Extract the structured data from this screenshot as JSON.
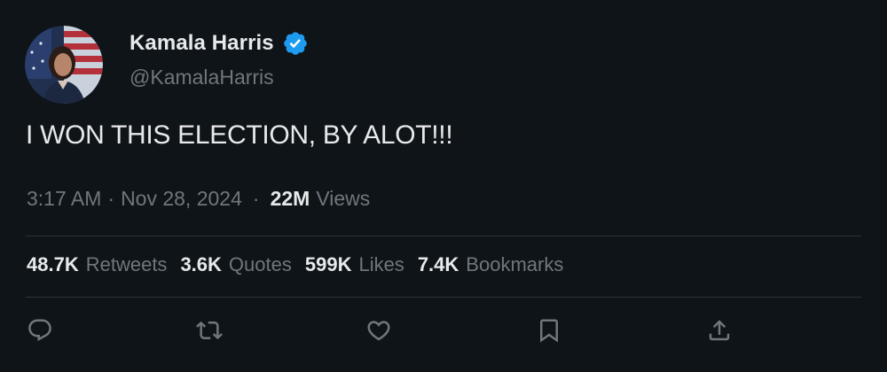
{
  "author": {
    "name": "Kamala Harris",
    "handle": "@KamalaHarris",
    "verified": true,
    "verified_color": "#1d9bf0"
  },
  "tweet": {
    "text": "I WON THIS ELECTION, BY ALOT!!!"
  },
  "meta": {
    "time": "3:17 AM",
    "separator": "·",
    "date": "Nov 28, 2024",
    "separator2": "·",
    "views_count": "22M",
    "views_label": "Views"
  },
  "stats": {
    "retweets": {
      "count": "48.7K",
      "label": "Retweets"
    },
    "quotes": {
      "count": "3.6K",
      "label": "Quotes"
    },
    "likes": {
      "count": "599K",
      "label": "Likes"
    },
    "bookmarks": {
      "count": "7.4K",
      "label": "Bookmarks"
    }
  },
  "actions": [
    "reply-icon",
    "retweet-icon",
    "like-icon",
    "bookmark-icon",
    "share-icon"
  ],
  "colors": {
    "background": "#0f1419",
    "text_primary": "#e7e9ea",
    "text_secondary": "#71767b",
    "divider": "#2f3336"
  }
}
